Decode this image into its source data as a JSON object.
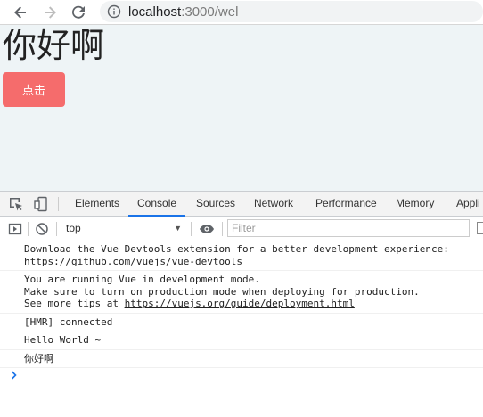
{
  "browser": {
    "url_host": "localhost",
    "url_path": ":3000/wel"
  },
  "page": {
    "heading": "你好啊",
    "button_label": "点击",
    "button_color": "#f56c6c"
  },
  "devtools": {
    "tabs": [
      "Elements",
      "Console",
      "Sources",
      "Network",
      "Performance",
      "Memory",
      "Appli"
    ],
    "active_tab": "Console",
    "context": "top",
    "filter_placeholder": "Filter",
    "logs": [
      {
        "lines": [
          "Download the Vue Devtools extension for a better development experience:"
        ],
        "link": "https://github.com/vuejs/vue-devtools"
      },
      {
        "lines": [
          "You are running Vue in development mode.",
          "Make sure to turn on production mode when deploying for production."
        ],
        "prefix": "See more tips at ",
        "link": "https://vuejs.org/guide/deployment.html"
      },
      {
        "lines": [
          "[HMR] connected"
        ]
      },
      {
        "lines": [
          "Hello World ~"
        ]
      },
      {
        "lines": [
          "你好啊"
        ]
      }
    ]
  },
  "icons": [
    "back-arrow-icon",
    "forward-arrow-icon",
    "reload-icon",
    "info-icon",
    "inspect-icon",
    "device-icon",
    "sidebar-toggle-icon",
    "clear-console-icon",
    "eye-icon",
    "prompt-chevron-icon"
  ],
  "colors": {
    "accent": "#1a73e8",
    "page_bg": "#eef4f6",
    "prompt": "#1a73e8"
  }
}
